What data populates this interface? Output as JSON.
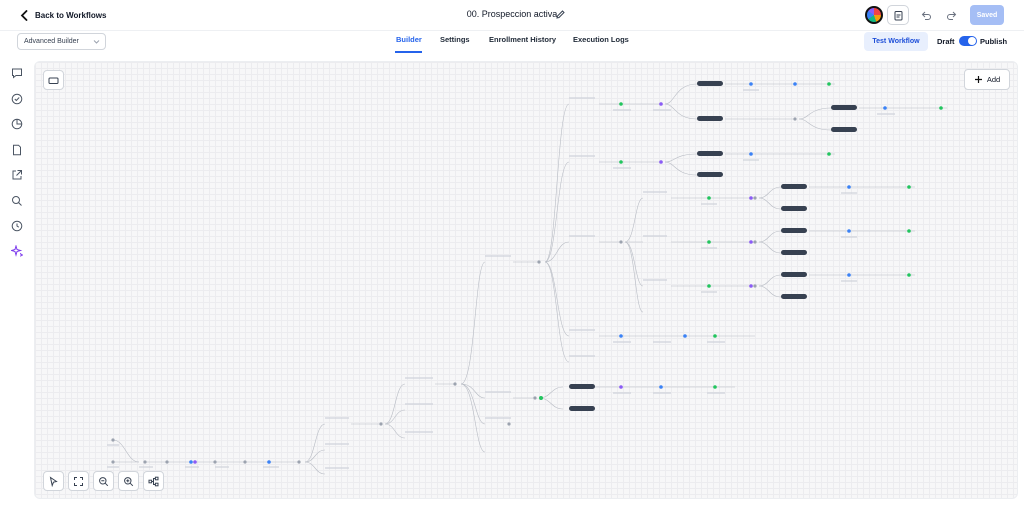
{
  "header": {
    "back_label": "Back to Workflows",
    "workflow_title": "00. Prospeccion activa",
    "saved_label": "Saved"
  },
  "subbar": {
    "builder_select": "Advanced Builder",
    "tabs": [
      {
        "label": "Builder",
        "active": true
      },
      {
        "label": "Settings",
        "active": false
      },
      {
        "label": "Enrollment History",
        "active": false
      },
      {
        "label": "Execution Logs",
        "active": false
      }
    ],
    "test_workflow_label": "Test Workflow",
    "draft_label": "Draft",
    "publish_label": "Publish",
    "publish_toggle_on": true
  },
  "rail": {
    "icons": [
      "comment-icon",
      "check-circle-icon",
      "pie-chart-icon",
      "document-icon",
      "external-link-icon",
      "search-icon",
      "history-icon",
      "sparkle-icon"
    ]
  },
  "canvas": {
    "add_label": "Add",
    "zoom_controls": [
      "select-pointer-icon",
      "fit-view-icon",
      "zoom-out-icon",
      "zoom-in-icon",
      "auto-layout-icon"
    ]
  },
  "colors": {
    "accent": "#2563eb",
    "saved_button": "#a5bef5",
    "test_button_bg": "#e8effd",
    "node_dark": "#374151",
    "node_green": "#22c55e",
    "node_purple": "#8b5cf6",
    "node_blue": "#3b82f6"
  }
}
